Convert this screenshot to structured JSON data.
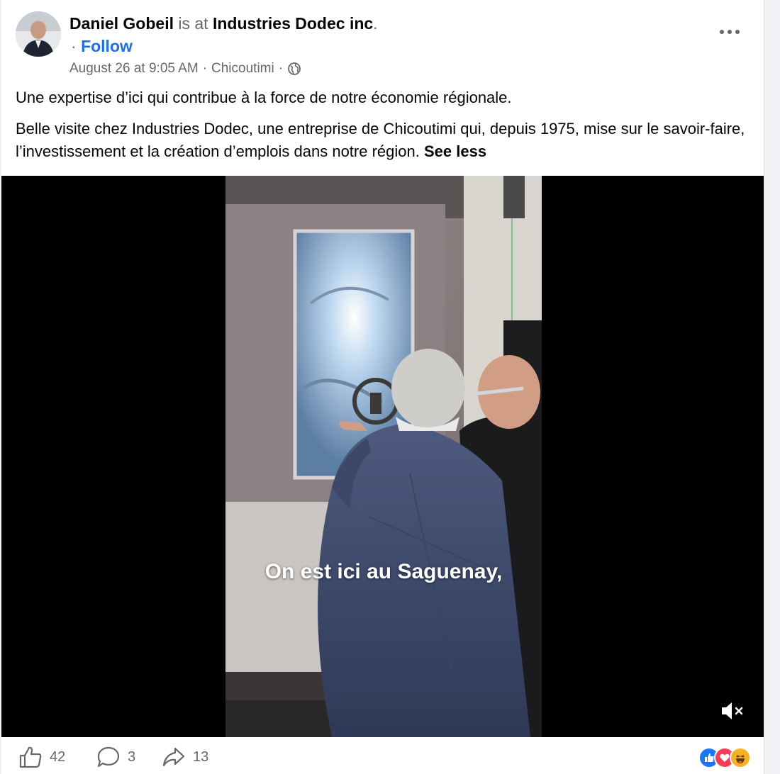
{
  "post": {
    "author": "Daniel Gobeil",
    "is_at": "is at",
    "place": "Industries Dodec inc",
    "period": ".",
    "follow_sep": "· ",
    "follow_label": "Follow",
    "date": "August 26 at 9:05 AM",
    "sep": "·",
    "location": "Chicoutimi",
    "audience_icon": "globe-icon",
    "paragraph1": "Une expertise d’ici qui contribue à la force de notre économie régionale.",
    "paragraph2": "Belle visite chez Industries Dodec, une entreprise de Chicoutimi qui, depuis 1975, mise sur le savoir-faire, l’investissement et la création d’emplois dans notre région.",
    "see_less": "See less"
  },
  "video": {
    "caption": "On est ici au Saguenay,",
    "mute_icon": "speaker-muted-icon"
  },
  "footer": {
    "like_count": "42",
    "comment_count": "3",
    "share_count": "13",
    "reactions": [
      "like-reaction-icon",
      "love-reaction-icon",
      "haha-reaction-icon"
    ]
  },
  "colors": {
    "link": "#216fdb",
    "muted_text": "#65676b",
    "text": "#050505",
    "like_blue": "#1877f2",
    "love_red": "#f33e58",
    "haha_yellow": "#f7b125"
  }
}
